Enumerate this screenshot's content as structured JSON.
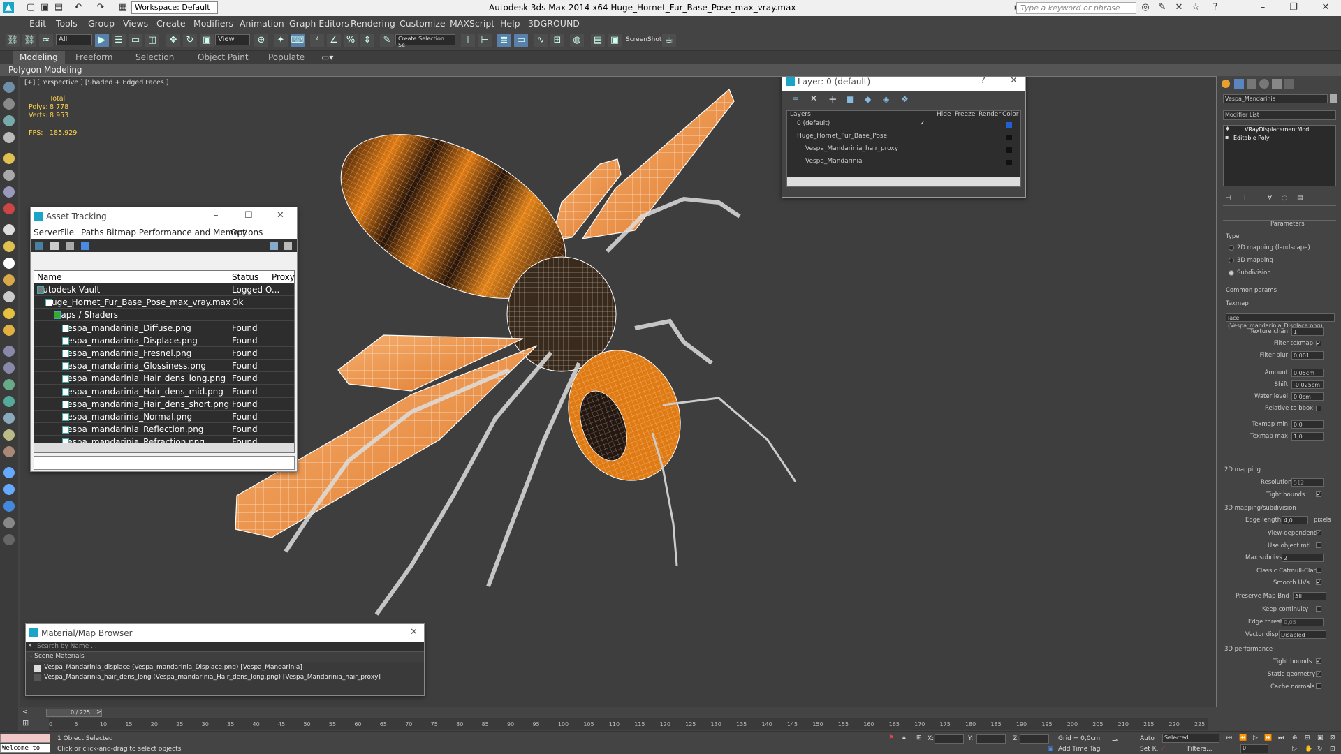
{
  "titlebar": {
    "workspace": "Workspace: Default",
    "title": "Autodesk 3ds Max  2014 x64     Huge_Hornet_Fur_Base_Pose_max_vray.max",
    "search_placeholder": "Type a keyword or phrase"
  },
  "menu": [
    "Edit",
    "Tools",
    "Group",
    "Views",
    "Create",
    "Modifiers",
    "Animation",
    "Graph Editors",
    "Rendering",
    "Customize",
    "MAXScript",
    "Help",
    "3DGROUND"
  ],
  "toolbar": {
    "filter_select": "All",
    "ref_coord": "View",
    "named_selection": "Create Selection Se",
    "screenshot_label": "ScreenShot"
  },
  "ribbon": {
    "tabs": [
      "Modeling",
      "Freeform",
      "Selection",
      "Object Paint",
      "Populate"
    ],
    "subtitle": "Polygon Modeling"
  },
  "viewport": {
    "label": "[+] [Perspective ] [Shaded + Edged Faces ]",
    "stats": {
      "total_label": "Total",
      "polys_label": "Polys:",
      "polys": "8 778",
      "verts_label": "Verts:",
      "verts": "8 953",
      "fps_label": "FPS:",
      "fps": "185,929"
    }
  },
  "asset_tracking": {
    "title": "Asset Tracking",
    "menu": [
      "Server",
      "File",
      "Paths",
      "Bitmap Performance and Memory",
      "Options"
    ],
    "columns": [
      "Name",
      "Status",
      "Proxy"
    ],
    "rows": [
      {
        "name": "Autodesk Vault",
        "status": "Logged O...",
        "indent": 0
      },
      {
        "name": "Huge_Hornet_Fur_Base_Pose_max_vray.max",
        "status": "Ok",
        "indent": 1
      },
      {
        "name": "Maps / Shaders",
        "status": "",
        "indent": 2
      },
      {
        "name": "Vespa_mandarinia_Diffuse.png",
        "status": "Found",
        "indent": 3
      },
      {
        "name": "Vespa_mandarinia_Displace.png",
        "status": "Found",
        "indent": 3
      },
      {
        "name": "Vespa_mandarinia_Fresnel.png",
        "status": "Found",
        "indent": 3
      },
      {
        "name": "Vespa_mandarinia_Glossiness.png",
        "status": "Found",
        "indent": 3
      },
      {
        "name": "Vespa_mandarinia_Hair_dens_long.png",
        "status": "Found",
        "indent": 3
      },
      {
        "name": "Vespa_mandarinia_Hair_dens_mid.png",
        "status": "Found",
        "indent": 3
      },
      {
        "name": "Vespa_mandarinia_Hair_dens_short.png",
        "status": "Found",
        "indent": 3
      },
      {
        "name": "Vespa_mandarinia_Normal.png",
        "status": "Found",
        "indent": 3
      },
      {
        "name": "Vespa_mandarinia_Reflection.png",
        "status": "Found",
        "indent": 3
      },
      {
        "name": "Vespa_mandarinia_Refraction.png",
        "status": "Found",
        "indent": 3
      }
    ]
  },
  "layers": {
    "title": "Layer: 0 (default)",
    "columns": [
      "Layers",
      "Hide",
      "Freeze",
      "Render",
      "Color"
    ],
    "rows": [
      {
        "name": "0 (default)"
      },
      {
        "name": "Huge_Hornet_Fur_Base_Pose"
      },
      {
        "name": "Vespa_Mandarinia_hair_proxy"
      },
      {
        "name": "Vespa_Mandarinia"
      }
    ]
  },
  "material_browser": {
    "title": "Material/Map Browser",
    "search_placeholder": "Search by Name ...",
    "section": "- Scene Materials",
    "items": [
      "Vespa_Mandarinia_displace (Vespa_mandarinia_Displace.png) [Vespa_Mandarinia]",
      "Vespa_Mandarinia_hair_dens_long (Vespa_mandarinia_Hair_dens_long.png) [Vespa_Mandarinia_hair_proxy]"
    ]
  },
  "command_panel": {
    "object_name": "Vespa_Mandarinia",
    "modifier_list": "Modifier List",
    "stack": [
      "VRayDisplacementMod",
      "Editable Poly"
    ],
    "rollout": "Parameters",
    "type_label": "Type",
    "type_options": [
      "2D mapping (landscape)",
      "3D mapping",
      "Subdivision"
    ],
    "common_params": "Common params",
    "texmap_label": "Texmap",
    "texmap_value": "lace (Vespa_mandarinia_Displace.png)",
    "fields": [
      {
        "label": "Texture chan",
        "value": "1"
      },
      {
        "label": "Filter texmap",
        "value": ""
      },
      {
        "label": "Filter blur",
        "value": "0,001"
      },
      {
        "label": "Amount",
        "value": "0,05cm"
      },
      {
        "label": "Shift",
        "value": "-0,025cm"
      },
      {
        "label": "Water level",
        "value": "0,0cm"
      },
      {
        "label": "Relative to bbox",
        "value": ""
      },
      {
        "label": "Texmap min",
        "value": "0,0"
      },
      {
        "label": "Texmap max",
        "value": "1,0"
      }
    ],
    "mapping2d": "2D mapping",
    "resolution_label": "Resolution",
    "resolution_value": "512",
    "tight_bounds": "Tight bounds",
    "mapping3d": "3D mapping/subdivision",
    "edge_length_label": "Edge length",
    "edge_length_value": "4,0",
    "pixels_label": "pixels",
    "checks3d": [
      "View-dependent",
      "Use object mtl"
    ],
    "max_subdivs_label": "Max subdivs",
    "max_subdivs_value": "2",
    "checks3d_b": [
      "Classic Catmull-Clark",
      "Smooth UVs"
    ],
    "preserve_label": "Preserve Map Bnd",
    "preserve_value": "All",
    "keep_continuity": "Keep continuity",
    "edge_thresh_label": "Edge thresh",
    "edge_thresh_value": "0,05",
    "vector_label": "Vector displ",
    "vector_value": "Disabled",
    "perf_label": "3D performance",
    "perf_checks": [
      "Tight bounds",
      "Static geometry",
      "Cache normals"
    ]
  },
  "timeline": {
    "frame": "0 / 225",
    "ticks": [
      "0",
      "5",
      "10",
      "15",
      "20",
      "25",
      "30",
      "35",
      "40",
      "45",
      "50",
      "55",
      "60",
      "65",
      "70",
      "75",
      "80",
      "85",
      "90",
      "95",
      "100",
      "105",
      "110",
      "115",
      "120",
      "125",
      "130",
      "135",
      "140",
      "145",
      "150",
      "155",
      "160",
      "165",
      "170",
      "175",
      "180",
      "185",
      "190",
      "195",
      "200",
      "205",
      "210",
      "215",
      "220",
      "225"
    ]
  },
  "status": {
    "welcome": "Welcome to",
    "selected": "1 Object Selected",
    "prompt": "Click or click-and-drag to select objects",
    "x_label": "X:",
    "y_label": "Y:",
    "z_label": "Z:",
    "grid": "Grid = 0,0cm",
    "auto": "Auto",
    "selected_dd": "Selected",
    "setk": "Set K.",
    "filters": "Filters...",
    "add_time_tag": "Add Time Tag",
    "frame_field": "0"
  }
}
